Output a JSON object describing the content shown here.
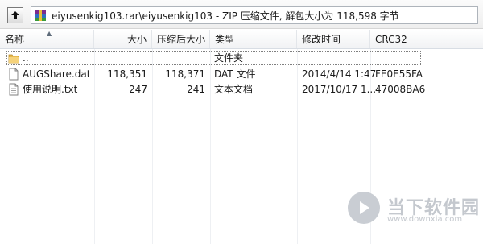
{
  "pathbar": {
    "up_icon": "up-folder-icon",
    "archive_icon": "rar-archive-icon",
    "path": "eiyusenkig103.rar\\eiyusenkig103 - ZIP 压缩文件, 解包大小为 118,598 字节"
  },
  "columns": {
    "name": "名称",
    "size": "大小",
    "packed": "压缩后大小",
    "type": "类型",
    "modified": "修改时间",
    "crc": "CRC32"
  },
  "rows": [
    {
      "icon": "folder-icon",
      "name": "..",
      "size": "",
      "packed": "",
      "type": "文件夹",
      "modified": "",
      "crc": ""
    },
    {
      "icon": "file-icon",
      "name": "AUGShare.dat",
      "size": "118,351",
      "packed": "118,371",
      "type": "DAT 文件",
      "modified": "2014/4/14 1:47",
      "crc": "FE0E55FA"
    },
    {
      "icon": "text-file-icon",
      "name": "使用说明.txt",
      "size": "247",
      "packed": "241",
      "type": "文本文档",
      "modified": "2017/10/17 1...",
      "crc": "47008BA6"
    }
  ],
  "watermark": {
    "brand": "当下软件园",
    "url": "www.downxia.com"
  }
}
